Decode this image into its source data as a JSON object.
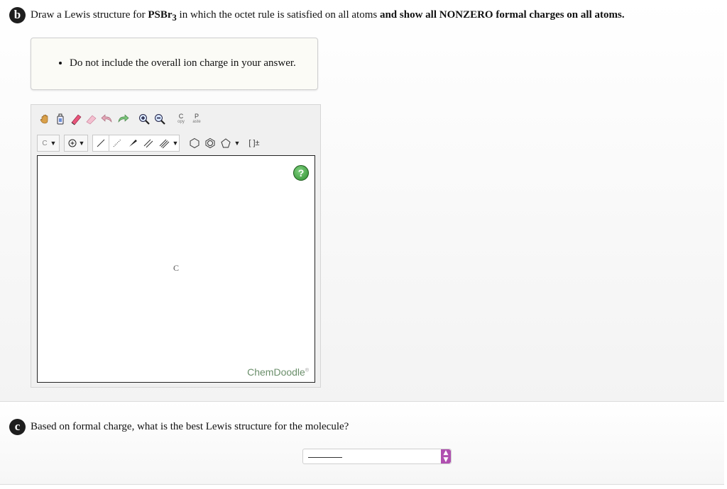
{
  "part_b": {
    "badge": "b",
    "prompt_pre": "Draw a Lewis structure for ",
    "formula_main": "PSBr",
    "formula_sub": "3",
    "prompt_mid": " in which the octet rule is satisfied on all atoms ",
    "prompt_bold": "and show all NONZERO formal charges on all atoms.",
    "hint": "Do not include the overall ion charge in your answer."
  },
  "toolbar": {
    "copy_top": "C",
    "copy_bottom": "opy",
    "paste_top": "P",
    "paste_bottom": "aste",
    "atom_label": "C",
    "bracket_label": "[ ]±"
  },
  "canvas": {
    "help": "?",
    "atom": "C",
    "brand": "ChemDoodle",
    "brand_mark": "®"
  },
  "part_c": {
    "badge": "c",
    "question": "Based on formal charge, what is the best Lewis structure for the molecule?",
    "select_caret_up": "▲",
    "select_caret_down": "▼"
  },
  "colors": {
    "badge_bg": "#1e1e1e",
    "select_accent": "#b04fb0",
    "help_green": "#2f8f2f",
    "brand_text": "#6b8f6b"
  }
}
